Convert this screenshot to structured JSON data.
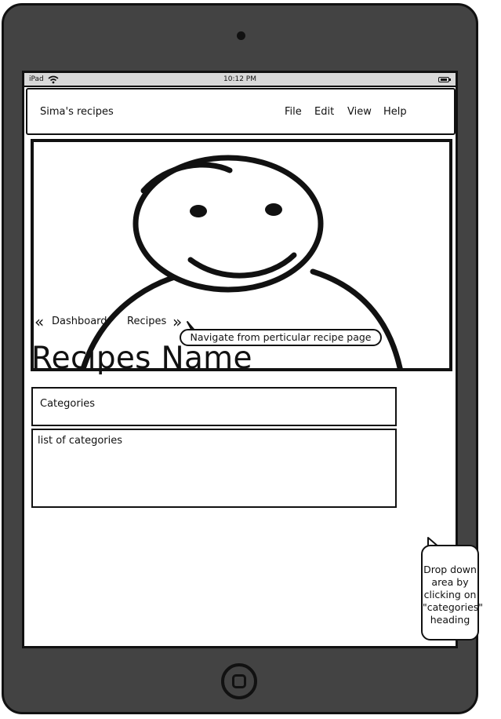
{
  "status_bar": {
    "carrier": "iPad",
    "time": "10:12 PM"
  },
  "menu_bar": {
    "app_title": "Sima's recipes",
    "items": [
      {
        "label": "File"
      },
      {
        "label": "Edit"
      },
      {
        "label": "View"
      },
      {
        "label": "Help"
      }
    ]
  },
  "breadcrumb": {
    "back_glyph": "«",
    "items": [
      {
        "label": "Dashboard"
      },
      {
        "label": "Recipes"
      }
    ],
    "forward_glyph": "»"
  },
  "annotations": {
    "breadcrumb_note": "Navigate from perticular recipe page",
    "dropdown_note_lines": [
      "Drop down",
      "area by",
      "clicking on",
      "\"categories\"",
      "heading"
    ]
  },
  "page": {
    "title": "Recipes Name"
  },
  "categories": {
    "header_label": "Categories",
    "body_text": "list of categories"
  },
  "icons": {
    "image": "avatar-placeholder-icon",
    "wifi": "wifi-icon",
    "battery": "battery-icon",
    "home": "home-button-icon"
  },
  "colors": {
    "device_body": "#434343",
    "status_bar": "#d9d9d9",
    "outline": "#111111"
  }
}
